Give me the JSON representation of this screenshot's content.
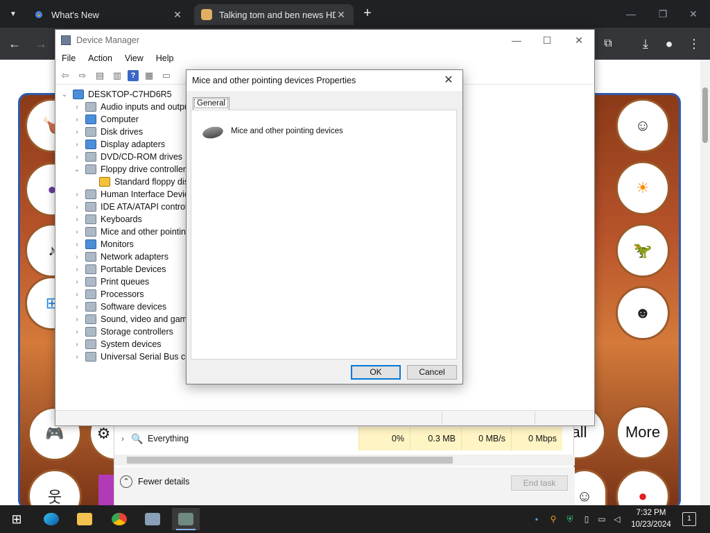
{
  "browser": {
    "tabs": [
      {
        "title": "What's New",
        "active": false
      },
      {
        "title": "Talking tom and ben news HD",
        "active": true
      }
    ],
    "new_tab": "+",
    "window_buttons": [
      "—",
      "❐",
      "✕"
    ],
    "toolbar_icons": {
      "back": "←",
      "forward": "→",
      "extensions": "⧉",
      "download": "⤓",
      "profile": "●",
      "menu": "⋮"
    }
  },
  "game": {
    "more_label": "More",
    "partial_label": "all"
  },
  "device_manager": {
    "title": "Device Manager",
    "menu": [
      "File",
      "Action",
      "View",
      "Help"
    ],
    "tree_root": "DESKTOP-C7HD6R5",
    "categories": [
      {
        "label": "Audio inputs and outputs",
        "expanded": false
      },
      {
        "label": "Computer",
        "expanded": false
      },
      {
        "label": "Disk drives",
        "expanded": false
      },
      {
        "label": "Display adapters",
        "expanded": false
      },
      {
        "label": "DVD/CD-ROM drives",
        "expanded": false
      },
      {
        "label": "Floppy drive controllers",
        "expanded": true
      },
      {
        "label": "Standard floppy disk controller",
        "expanded": null,
        "child": true
      },
      {
        "label": "Human Interface Devices",
        "expanded": false
      },
      {
        "label": "IDE ATA/ATAPI controllers",
        "expanded": false
      },
      {
        "label": "Keyboards",
        "expanded": false
      },
      {
        "label": "Mice and other pointing devices",
        "expanded": false
      },
      {
        "label": "Monitors",
        "expanded": false
      },
      {
        "label": "Network adapters",
        "expanded": false
      },
      {
        "label": "Portable Devices",
        "expanded": false
      },
      {
        "label": "Print queues",
        "expanded": false
      },
      {
        "label": "Processors",
        "expanded": false
      },
      {
        "label": "Software devices",
        "expanded": false
      },
      {
        "label": "Sound, video and game controllers",
        "expanded": false
      },
      {
        "label": "Storage controllers",
        "expanded": false
      },
      {
        "label": "System devices",
        "expanded": false
      },
      {
        "label": "Universal Serial Bus controllers",
        "expanded": false
      }
    ]
  },
  "properties_dialog": {
    "title": "Mice and other pointing devices Properties",
    "tab": "General",
    "device_name": "Mice and other pointing devices",
    "ok_label": "OK",
    "cancel_label": "Cancel",
    "close": "✕"
  },
  "task_manager": {
    "process_name": "Everything",
    "cpu": "0%",
    "memory": "0.3 MB",
    "disk": "0 MB/s",
    "network": "0 Mbps",
    "fewer_details": "Fewer details",
    "end_task": "End task"
  },
  "taskbar": {
    "time": "7:32 PM",
    "date": "10/23/2024",
    "notification_count": "1"
  }
}
